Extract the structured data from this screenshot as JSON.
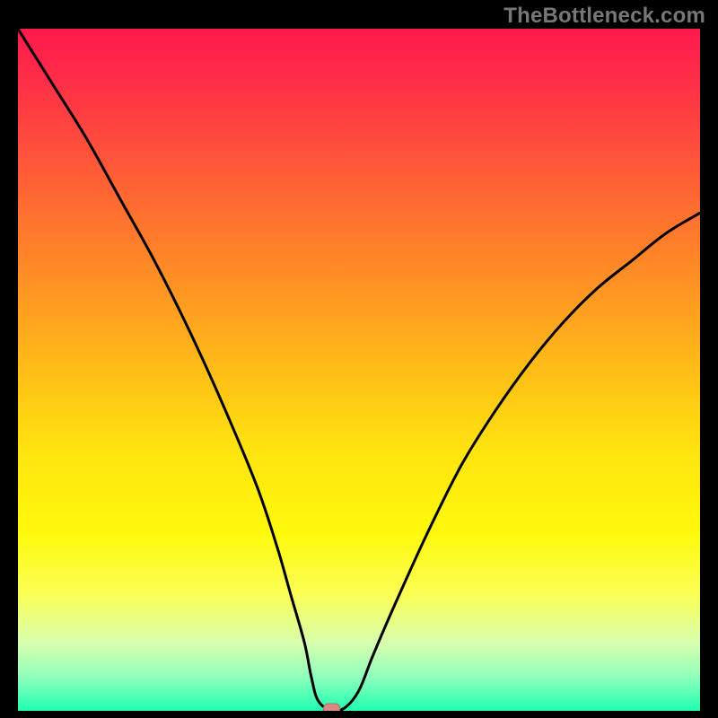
{
  "attribution": "TheBottleneck.com",
  "colors": {
    "frame": "#000000",
    "attribution_text": "#777777",
    "curve": "#000000",
    "marker_fill": "#d98a82",
    "marker_stroke": "#c06a60",
    "gradient_stops": [
      {
        "offset": 0.0,
        "color": "#ff1a4d"
      },
      {
        "offset": 0.08,
        "color": "#ff2f47"
      },
      {
        "offset": 0.2,
        "color": "#ff5838"
      },
      {
        "offset": 0.35,
        "color": "#ff8a26"
      },
      {
        "offset": 0.5,
        "color": "#ffbd17"
      },
      {
        "offset": 0.62,
        "color": "#ffe40f"
      },
      {
        "offset": 0.74,
        "color": "#fff90c"
      },
      {
        "offset": 0.83,
        "color": "#fbff57"
      },
      {
        "offset": 0.9,
        "color": "#d8ffad"
      },
      {
        "offset": 0.95,
        "color": "#8fffbc"
      },
      {
        "offset": 1.0,
        "color": "#1effb0"
      }
    ]
  },
  "chart_data": {
    "type": "line",
    "title": "",
    "xlabel": "",
    "ylabel": "",
    "xlim": [
      0,
      100
    ],
    "ylim": [
      0,
      100
    ],
    "grid": false,
    "legend": false,
    "marker": {
      "x": 46,
      "y": 0,
      "shape": "rounded-rect"
    },
    "x": [
      0,
      5,
      10,
      15,
      20,
      25,
      30,
      35,
      38,
      40,
      42,
      43,
      44,
      46,
      48,
      50,
      52,
      55,
      60,
      65,
      70,
      75,
      80,
      85,
      90,
      95,
      100
    ],
    "values": [
      100,
      92,
      84,
      75,
      66,
      56,
      45,
      33,
      24,
      17,
      10,
      5,
      1.5,
      0,
      0.5,
      3,
      8,
      15,
      26,
      36,
      44,
      51,
      57,
      62,
      66,
      70,
      73
    ]
  }
}
